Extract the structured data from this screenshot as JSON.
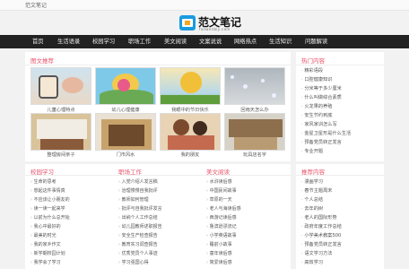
{
  "topbar": {
    "text": "范文笔记"
  },
  "logo": {
    "title": "范文笔记",
    "subtitle": "fanwenbiji.com"
  },
  "nav": [
    "首页",
    "生活语录",
    "校园学习",
    "职场工作",
    "美文阅读",
    "文案说说",
    "网络热点",
    "生活知识",
    "问题解读"
  ],
  "gallery": {
    "title": "图文推荐",
    "captions": [
      "儿童心理特点",
      "幼儿心理健康",
      "我眼中的节日快乐",
      "回雨天怎么办",
      "整理房间亲子",
      "门市风水",
      "我的朋友",
      "玩具店名字"
    ]
  },
  "hot": {
    "title": "热门内容",
    "items": [
      "精彩语段",
      "口腔健康知识",
      "分米等于多少厘米",
      "什么叫做综合素质",
      "火龙果的养殖",
      "安生节约到底",
      "家风家训怎么写",
      "金星卫星形是什么生活",
      "预备党员转正发言",
      "专业开题"
    ]
  },
  "columns": [
    {
      "title": "校园学习",
      "items": [
        "生命的思考",
        "想起这件事情真",
        "不应该让小朋友的",
        "读一读一起来学",
        "以前为什么总开始",
        "我心中最好的",
        "最美的时光",
        "我的家乡作文",
        "新学期校园计划",
        "我学会了学习"
      ]
    },
    {
      "title": "职场工作",
      "items": [
        "入党介绍人发言稿",
        "治理慢慢自我批评",
        "教师如何管理",
        "批评与自我批评发言",
        "出纳个人工作总结",
        "幼儿园教师述职报告",
        "安全生产检查报告",
        "教育实习调查报告",
        "优秀党员个人事迹",
        "学习强国心得"
      ]
    },
    {
      "title": "美文阅读",
      "items": [
        "水浒读后感",
        "中国民间故事",
        "草原的一天",
        "老人与海读后感",
        "西游记读后感",
        "鲁滨逊漂流记",
        "小学英语故事",
        "睡前小故事",
        "童年读后感",
        "简爱读后感"
      ]
    }
  ],
  "recommend": {
    "title": "推荐内容",
    "items": [
      "漫画学习",
      "春节主题周末",
      "个人总结",
      "去年的树",
      "老人的国际形势",
      "政府年度工作总结",
      "小学美术教案500",
      "预备党员转正发言",
      "语文学习方法",
      "高效学习"
    ]
  }
}
